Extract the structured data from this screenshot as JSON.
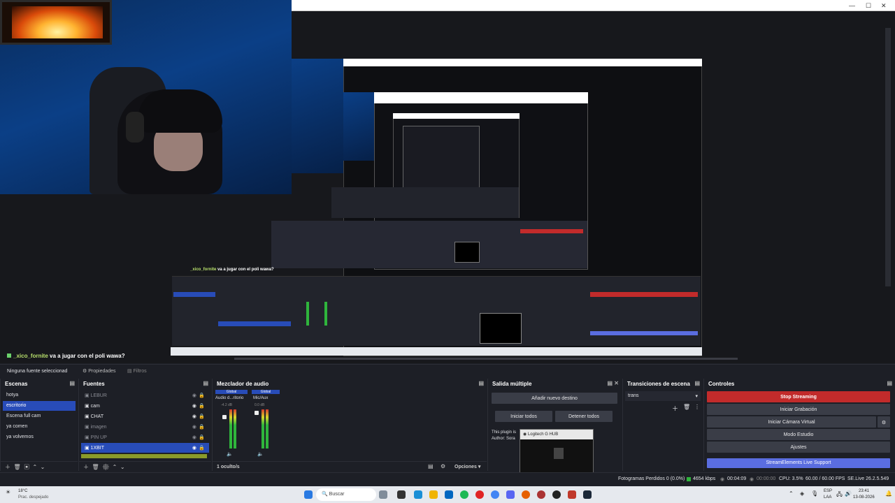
{
  "preview": {
    "chat_user": "_xico_fornite",
    "chat_message": " va a jugar con el poli wawa?",
    "nested_chat_user": "_xico_fornite",
    "nested_chat_message": " va a jugar con el poli wawa?"
  },
  "source_bar": {
    "no_source": "Ninguna fuente seleccionad",
    "properties": "Propiedades",
    "filters": "Filtros"
  },
  "scenes": {
    "title": "Escenas",
    "items": [
      {
        "label": "hotya",
        "selected": false
      },
      {
        "label": "escritorio",
        "selected": true
      },
      {
        "label": "Escena full cam",
        "selected": false
      },
      {
        "label": "ya comen",
        "selected": false
      },
      {
        "label": "ya volvemos",
        "selected": false
      }
    ]
  },
  "sources": {
    "title": "Fuentes",
    "items": [
      {
        "label": "LEBUR",
        "icon": "layers-icon",
        "selected": false,
        "dim": true
      },
      {
        "label": "cam",
        "icon": "camera-icon",
        "selected": false,
        "dim": false
      },
      {
        "label": "CHAT",
        "icon": "globe-icon",
        "selected": false,
        "dim": false
      },
      {
        "label": "imagen",
        "icon": "image-icon",
        "selected": false,
        "dim": true
      },
      {
        "label": "PIN UP",
        "icon": "browser-icon",
        "selected": false,
        "dim": true
      },
      {
        "label": "1XBIT",
        "icon": "browser-icon",
        "selected": true,
        "dim": false
      }
    ]
  },
  "mixer": {
    "title": "Mezclador de audio",
    "channels": [
      {
        "tag": "Global",
        "name": "Audio d...ritorio",
        "db": "-4.2 dB"
      },
      {
        "tag": "Global",
        "name": "Mic/Aux",
        "db": "0.0 dB"
      }
    ],
    "hidden": "1 oculto/s",
    "options": "Opciones"
  },
  "multi": {
    "title": "Salida múltiple",
    "add": "Añadir nuevo destino",
    "start_all": "Iniciar todos",
    "stop_all": "Detener todos",
    "plugin_text": "This plugin is",
    "author_text": "Author: Sora"
  },
  "transitions": {
    "title": "Transiciones de escena",
    "current": "trans"
  },
  "controls": {
    "title": "Controles",
    "stop_streaming": "Stop Streaming",
    "start_recording": "Iniciar Grabación",
    "virtual_cam": "Iniciar Cámara Virtual",
    "studio_mode": "Modo Estudio",
    "settings": "Ajustes",
    "se_support": "StreamElements Live Support"
  },
  "popup": {
    "title": "Logitech G HUB"
  },
  "status": {
    "dropped": "Fotogramas Perdidos 0 (0.0%)",
    "kbps": "4654 kbps",
    "live_time": "00:04:09",
    "rec_time": "00:00:00",
    "cpu": "CPU: 3.5%",
    "fps": "60.00 / 60.00 FPS",
    "version": "SE.Live 26.2.5.549"
  },
  "taskbar": {
    "weather_temp": "18°C",
    "weather_desc": "Prac. despejado",
    "search": "Buscar",
    "lang": "ESP",
    "lang2": "LAA",
    "time": "23:41",
    "date": "13-08-2026"
  },
  "colors": {
    "accent": "#284cb8",
    "stop": "#c22b2b",
    "se_support": "#5a6de0"
  }
}
